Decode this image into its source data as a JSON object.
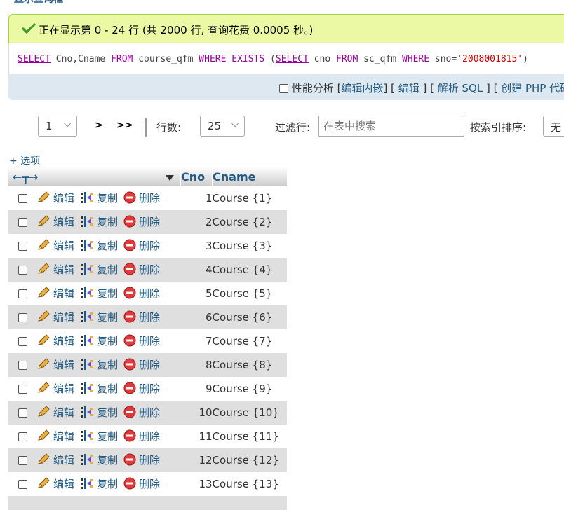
{
  "page": {
    "cut_heading": "显示查询框"
  },
  "success": {
    "message": "正在显示第 0 - 24 行 (共 2000 行, 查询花费 0.0005 秒。)"
  },
  "sql": {
    "k_select1": "SELECT",
    "t_fields": " Cno,Cname ",
    "k_from1": "FROM",
    "t_table": " course_qfm ",
    "k_where1": "WHERE",
    "t_sp1": " ",
    "k_exists": "EXISTS",
    "t_paren": " (",
    "k_select2": "SELECT",
    "t_cno": " cno ",
    "k_from2": "FROM",
    "t_sc": " sc_qfm ",
    "k_where2": "WHERE",
    "t_sno": " sno=",
    "s_val": "'2008001815'",
    "t_close": ")"
  },
  "toolbar": {
    "profiling": "性能分析",
    "edit_inline": "编辑内嵌",
    "edit": "编辑",
    "explain": "解析 SQL",
    "create_php": "创建 PHP 代码"
  },
  "nav": {
    "page_value": "1",
    "next": ">",
    "last": ">>",
    "rows_label": "行数:",
    "rows_value": "25",
    "filter_label": "过滤行:",
    "search_placeholder": "在表中搜索",
    "sort_label": "按索引排序:",
    "sort_value": "无"
  },
  "options_link": "+ 选项",
  "table": {
    "columns": [
      "Cno",
      "Cname"
    ],
    "action_edit": "编辑",
    "action_copy": "复制",
    "action_delete": "删除",
    "rows": [
      {
        "cno": "1",
        "cname": "Course {1}"
      },
      {
        "cno": "2",
        "cname": "Course {2}"
      },
      {
        "cno": "3",
        "cname": "Course {3}"
      },
      {
        "cno": "4",
        "cname": "Course {4}"
      },
      {
        "cno": "5",
        "cname": "Course {5}"
      },
      {
        "cno": "6",
        "cname": "Course {6}"
      },
      {
        "cno": "7",
        "cname": "Course {7}"
      },
      {
        "cno": "8",
        "cname": "Course {8}"
      },
      {
        "cno": "9",
        "cname": "Course {9}"
      },
      {
        "cno": "10",
        "cname": "Course {10}"
      },
      {
        "cno": "11",
        "cname": "Course {11}"
      },
      {
        "cno": "12",
        "cname": "Course {12}"
      },
      {
        "cno": "13",
        "cname": "Course {13}"
      }
    ]
  },
  "colors": {
    "link": "#235a81",
    "success_bg": "#ebf8a4",
    "toolbar_bg": "#dde8f0",
    "row_alt": "#dfdfdf"
  }
}
